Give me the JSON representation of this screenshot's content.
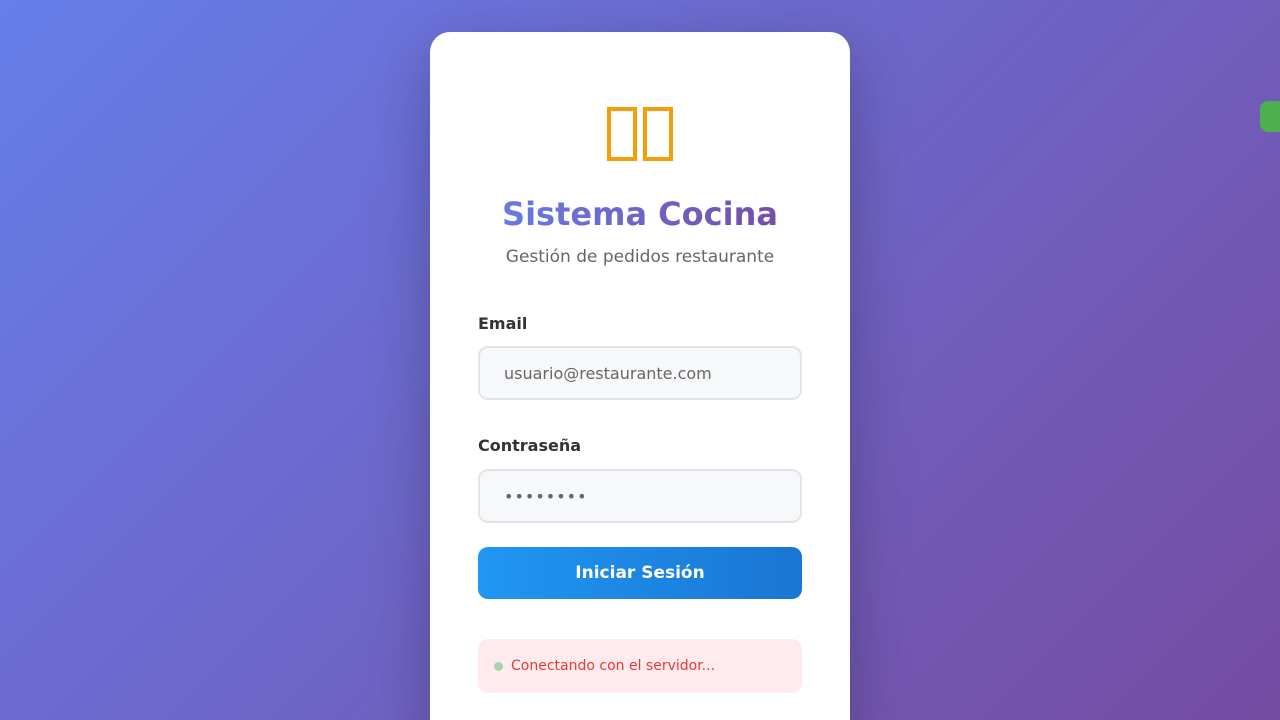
{
  "app": {
    "title": "Sistema Cocina",
    "subtitle": "Gestión de pedidos restaurante",
    "logo_icon": "tofu-glyph-icon"
  },
  "form": {
    "email_label": "Email",
    "email_placeholder": "usuario@restaurante.com",
    "password_label": "Contraseña",
    "password_value": "••••••••",
    "submit_label": "Iniciar Sesión"
  },
  "status": {
    "text": "Conectando con el servidor...",
    "dot_color": "#a5d6a7",
    "text_color": "#e53935"
  },
  "colors": {
    "background_start": "#667eea",
    "background_end": "#764ba2",
    "button_start": "#2196f3",
    "button_end": "#1976d2",
    "logo": "#f59e0b",
    "side_indicator": "#4caf50"
  }
}
